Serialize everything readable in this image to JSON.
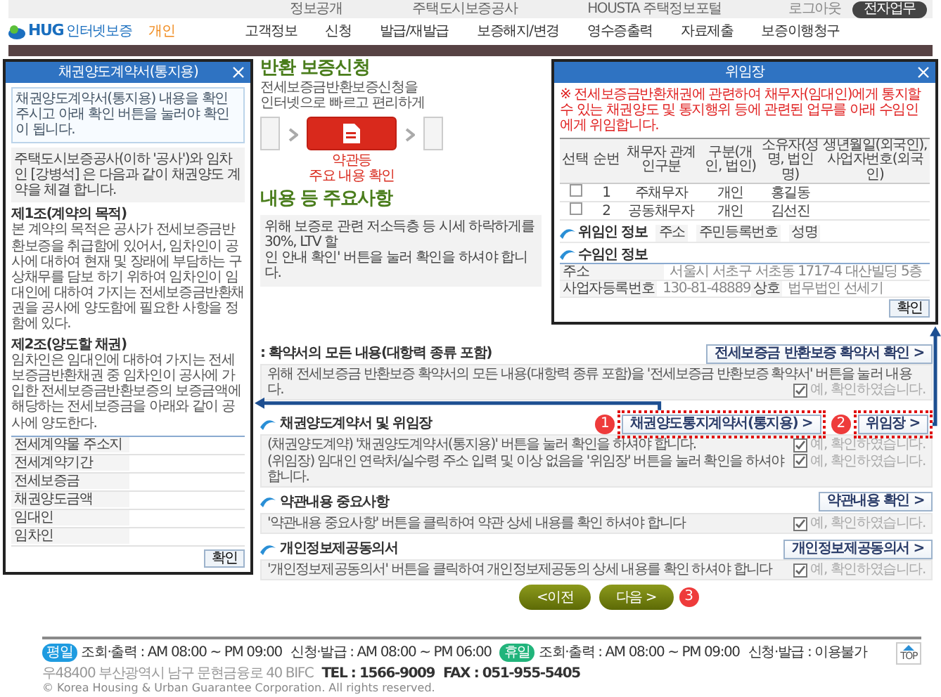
{
  "topbar": {
    "links": [
      "정보공개",
      "주택도시보증공사",
      "HOUSTA 주택정보포털"
    ],
    "logout": "로그아웃",
    "portal_button": "전자업무"
  },
  "header": {
    "brand": "HUG",
    "service": "인터넷보증",
    "user_type": "개인",
    "menu": [
      "고객정보",
      "신청",
      "발급/재발급",
      "보증해지/변경",
      "영수증출력",
      "자료제출",
      "보증이행청구"
    ]
  },
  "page": {
    "title": "반환 보증신청",
    "intro": [
      "전세보증금반환보증신청을",
      "인터넷으로 빠르고 편리하게"
    ]
  },
  "steps": [
    {
      "selected": false
    },
    {
      "selected": true,
      "label_lines": [
        "약관등",
        "주요 내용 확인"
      ]
    },
    {
      "selected": false
    }
  ],
  "section_heading": "내용 등 주요사항",
  "notice": [
    "위해 보증로 관련 저소득층 등 시세 하락하게를 30%, LTV 할",
    "인 안내 확인' 버튼을 눌러 확인을 하셔야 합니다."
  ],
  "sections": [
    {
      "bullet": false,
      "title": ": 확약서의 모든 내용(대항력 종류 포함)",
      "buttons": [
        {
          "label": "전세보증금 반환보증 확약서 확인 >",
          "highlighted": false
        }
      ],
      "rows": [
        {
          "text": "위해 전세보증금 반환보증 확약서의 모든 내용(대항력 종류 포함)을 '전세보증금 반환보증 확약서' 버튼을 눌러 내용"
        },
        {
          "text": "다.",
          "confirm": {
            "label": "예, 확인하였습니다.",
            "checked": true
          }
        }
      ]
    },
    {
      "bullet": true,
      "title": "채권양도계약서 및 위임장",
      "buttons": [
        {
          "label": "채권양도통지계약서(통지용) >",
          "highlighted": true,
          "marker": "1"
        },
        {
          "label": "위임장 >",
          "highlighted": true,
          "marker": "2"
        }
      ],
      "rows": [
        {
          "text": "(채권양도계약) '채권양도계약서(통지용)' 버튼을 눌러 확인을 하셔야 합니다.",
          "confirm": {
            "label": "예, 확인하였습니다.",
            "checked": true
          }
        },
        {
          "text": "(위임장) 임대인 연락처/실수령 주소 입력 및 이상 없음을 '위임장' 버튼을 눌러 확인을 하셔야 합니다.",
          "confirm": {
            "label": "예, 확인하였습니다.",
            "checked": true
          }
        }
      ]
    },
    {
      "bullet": true,
      "title": "약관내용 중요사항",
      "buttons": [
        {
          "label": "약관내용 확인 >",
          "highlighted": false
        }
      ],
      "rows": [
        {
          "text": "'약관내용 중요사항' 버튼을 클릭하여 약관 상세 내용를 확인 하셔야 합니다",
          "confirm": {
            "label": "예, 확인하였습니다.",
            "checked": true
          }
        }
      ]
    },
    {
      "bullet": true,
      "title": "개인정보제공동의서",
      "buttons": [
        {
          "label": "개인정보제공동의서 >",
          "highlighted": false
        }
      ],
      "rows": [
        {
          "text": "'개인정보제공동의서' 버튼을 클릭하여 개인정보제공동의 상세 내용를 확인 하셔야 합니다",
          "confirm": {
            "label": "예, 확인하였습니다.",
            "checked": true
          }
        }
      ]
    }
  ],
  "nav_buttons": [
    {
      "label": "<이전"
    },
    {
      "label": "다음 >",
      "marker": "3"
    }
  ],
  "contract_popup": {
    "title": "채권양도계약서(통지용)",
    "notice": "채권양도계약서(통지용) 내용을 확인 주시고 아래 확인 버튼을 눌러야 확인이 됩니다.",
    "intro": "주택도시보증공사(이하 '공사')와 임차인 [강병석] 은 다음과 같이 채권양도 계약을 체결 합니다.",
    "clauses": [
      {
        "heading": "제1조(계약의 목적)",
        "text": "본 계약의 목적은 공사가 전세보증금반환보증을 취급함에 있어서, 임차인이 공사에 대하여 현재 및 장래에 부담하는 구상채무를 담보 하기 위하여 임차인이 임대인에 대하여 가지는 전세보증금반환채권을 공사에 양도함에 필요한 사항을 정함에 있다."
      },
      {
        "heading": "제2조(양도할 채권)",
        "text": "임차인은 임대인에 대하여 가지는 전세보증금반환채권 중 임차인이 공사에 가입한 전세보증금반환보증의 보증금액에 해당하는 전세보증금을 아래와 같이 공사에 양도한다."
      }
    ],
    "fields": [
      "전세계약물 주소지",
      "전세계약기간",
      "전세보증금",
      "채권양도금액",
      "임대인",
      "임차인"
    ],
    "confirm": "확인"
  },
  "poa_popup": {
    "title": "위임장",
    "warning": "※ 전세보증금반환채권에 관련하여 채무자(임대인)에게 통지할 수 있는 채권양도 및 통지행위 등에 관련된 업무를 아래 수임인에게 위임합니다.",
    "columns": [
      "선택",
      "순번",
      "채무자 관계인구분",
      "구분(개인, 법인)",
      "소유자(성명, 법인명)",
      "생년월일(외국인), 사업자번호(외국인)"
    ],
    "rows": [
      {
        "checked": false,
        "cells": [
          "",
          "1",
          "주채무자",
          "개인",
          "홍길동"
        ]
      },
      {
        "checked": false,
        "cells": [
          "",
          "2",
          "공동채무자",
          "개인",
          "김선진"
        ]
      }
    ],
    "groups": [
      {
        "title": "위임인 정보",
        "fields": [
          {
            "label": "주소"
          },
          {
            "label": "주민등록번호"
          },
          {
            "label": "성명"
          }
        ]
      },
      {
        "title": "수임인 정보",
        "fields": [
          {
            "label": "주소",
            "value": "서울시 서초구 서초동 1717-4 대산빌딩 5층"
          },
          {
            "label": "사업자등록번호",
            "value": "130-81-48889"
          },
          {
            "label": "상호",
            "value": "법무법인 선세기"
          }
        ]
      }
    ],
    "confirm": "확인"
  },
  "footer": {
    "schedules": [
      {
        "badge": "평일",
        "color": "#1e9be0",
        "hours": [
          "조회·출력 : AM 08:00 ~ PM 09:00",
          "신청·발급 : AM 08:00 ~ PM 06:00"
        ]
      },
      {
        "badge": "휴일",
        "color": "#21b47b",
        "hours": [
          "조회·출력 : AM 08:00 ~ PM 09:00",
          "신청·발급 : 이용불가"
        ]
      }
    ],
    "address": "우48400 부산광역시 남구 문현금융로 40 BIFC",
    "tel": "TEL : 1566-9009",
    "fax": "FAX : 051-955-5405",
    "copyright": "© Korea Housing & Urban Guarantee Corporation. All rights reserved.",
    "top_button": "TOP"
  }
}
